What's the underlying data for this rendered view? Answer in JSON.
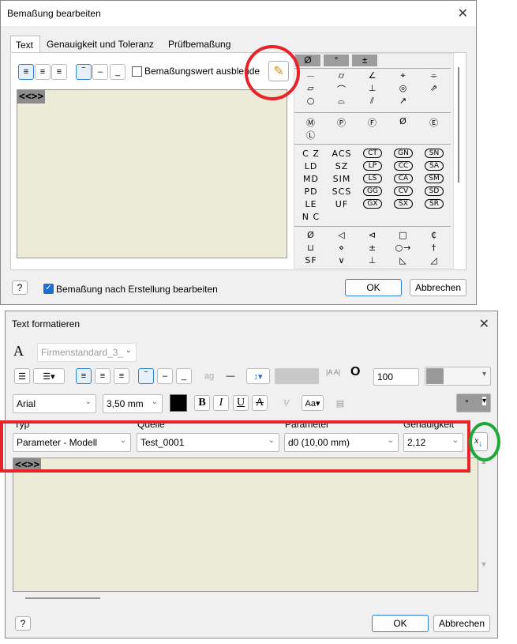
{
  "dialog1": {
    "title": "Bemaßung bearbeiten",
    "tabs": [
      "Text",
      "Genauigkeit und Toleranz",
      "Prüfbemaßung"
    ],
    "hide_value_label": "Bemaßungswert ausblende",
    "editor_tag": "<<>>",
    "symbol_tabs": [
      "Ø",
      "°",
      "±"
    ],
    "geo_symbols": [
      "⏤",
      "⌭",
      "∠",
      "⌖",
      "⌯",
      "▱",
      "⌒",
      "⊥",
      "◎",
      "⇗",
      "○",
      "⌓",
      "⫽",
      "↗"
    ],
    "modifiers": [
      "Ⓜ",
      "Ⓟ",
      "Ⓕ",
      "Ø",
      "Ⓔ",
      "Ⓛ"
    ],
    "codes": [
      "C Z",
      "ACS",
      "CT",
      "GN",
      "SN",
      "LD",
      "SZ",
      "LP",
      "CC",
      "SA",
      "MD",
      "SIM",
      "LS",
      "CA",
      "SM",
      "PD",
      "SCS",
      "GG",
      "CV",
      "SD",
      "LE",
      "UF",
      "GX",
      "SX",
      "SR",
      "N C"
    ],
    "misc_symbols": [
      "Ø",
      "◁",
      "⊲",
      "□",
      "₵",
      "⊔",
      "⋄",
      "±",
      "○→",
      "†",
      "SF",
      "∨",
      "⊥",
      "◺",
      "◿"
    ],
    "edit_after_label": "Bemaßung nach Erstellung bearbeiten",
    "ok": "OK",
    "cancel": "Abbrechen"
  },
  "dialog2": {
    "title": "Text formatieren",
    "style": "Firmenstandard_3_",
    "stretch": "100",
    "font": "Arial",
    "size": "3,50 mm",
    "labels": {
      "typ": "Typ",
      "quelle": "Quelle",
      "parameter": "Parameter",
      "genauigkeit": "Genauigkeit"
    },
    "typ": "Parameter - Modell",
    "quelle": "Test_0001",
    "parameter": "d0 (10,00 mm)",
    "genauigkeit": "2,12",
    "editor_tag": "<<>>",
    "symbol": "°",
    "ok": "OK",
    "cancel": "Abbrechen"
  },
  "colors": {
    "annotation_red": "#e8232a",
    "annotation_green": "#1fa83a",
    "editor_bg": "#ecebd7"
  }
}
